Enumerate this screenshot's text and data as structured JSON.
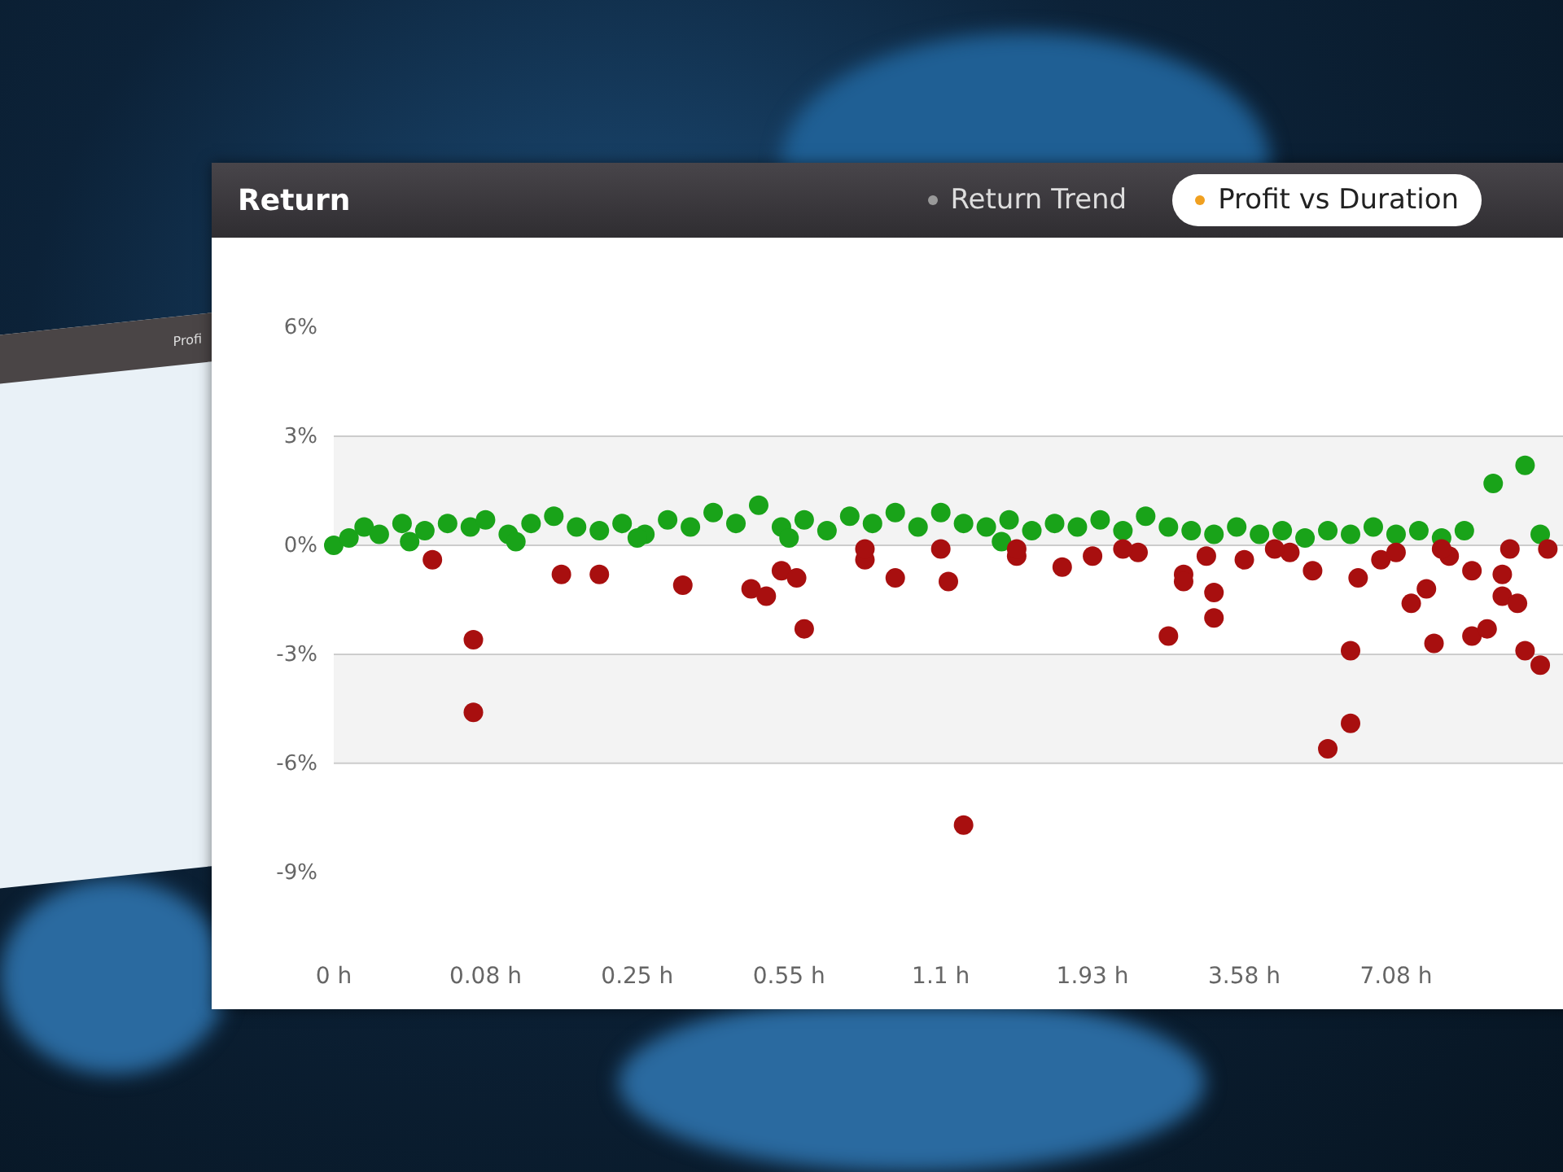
{
  "background_window": {
    "tab": "Profi"
  },
  "panel": {
    "title": "Return",
    "tabs": [
      {
        "label": "Return Trend",
        "selected": false
      },
      {
        "label": "Profit vs Duration",
        "selected": true
      }
    ],
    "chart": {
      "y_axis_labels": [
        "6%",
        "3%",
        "0%",
        "-3%",
        "-6%",
        "-9%"
      ],
      "x_axis_labels": [
        "0 h",
        "0.08 h",
        "0.25 h",
        "0.55 h",
        "1.1 h",
        "1.93 h",
        "3.58 h",
        "7.08 h"
      ]
    }
  }
}
